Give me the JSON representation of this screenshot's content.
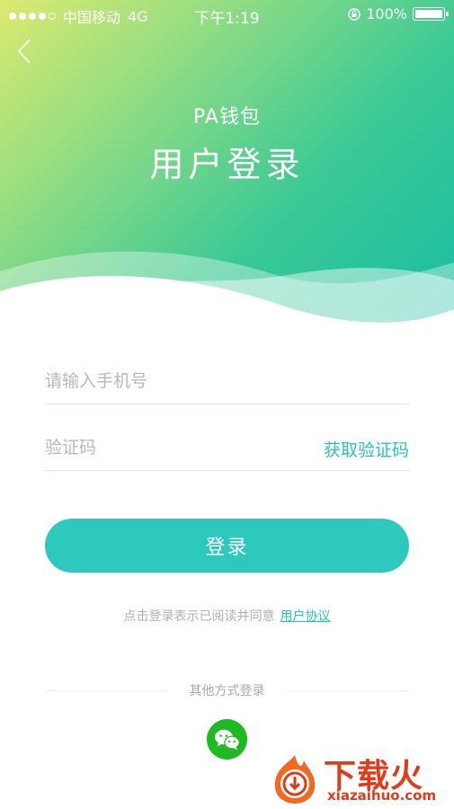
{
  "status_bar": {
    "carrier": "中国移动",
    "network": "4G",
    "time": "下午1:19",
    "battery": "100%"
  },
  "header": {
    "brand": "PA钱包",
    "title": "用户登录"
  },
  "form": {
    "phone_placeholder": "请输入手机号",
    "code_placeholder": "验证码",
    "get_code_label": "获取验证码",
    "login_label": "登录"
  },
  "agreement": {
    "text": "点击登录表示已阅读并同意",
    "link": "用户协议"
  },
  "other_login": {
    "label": "其他方式登录"
  },
  "watermark": {
    "text": "下载火",
    "domain": "xiazaihuo.com"
  },
  "colors": {
    "accent": "#2ec9bd",
    "link": "#2cc3b3",
    "wechat": "#1fb922",
    "watermark": "#e03b1a"
  }
}
